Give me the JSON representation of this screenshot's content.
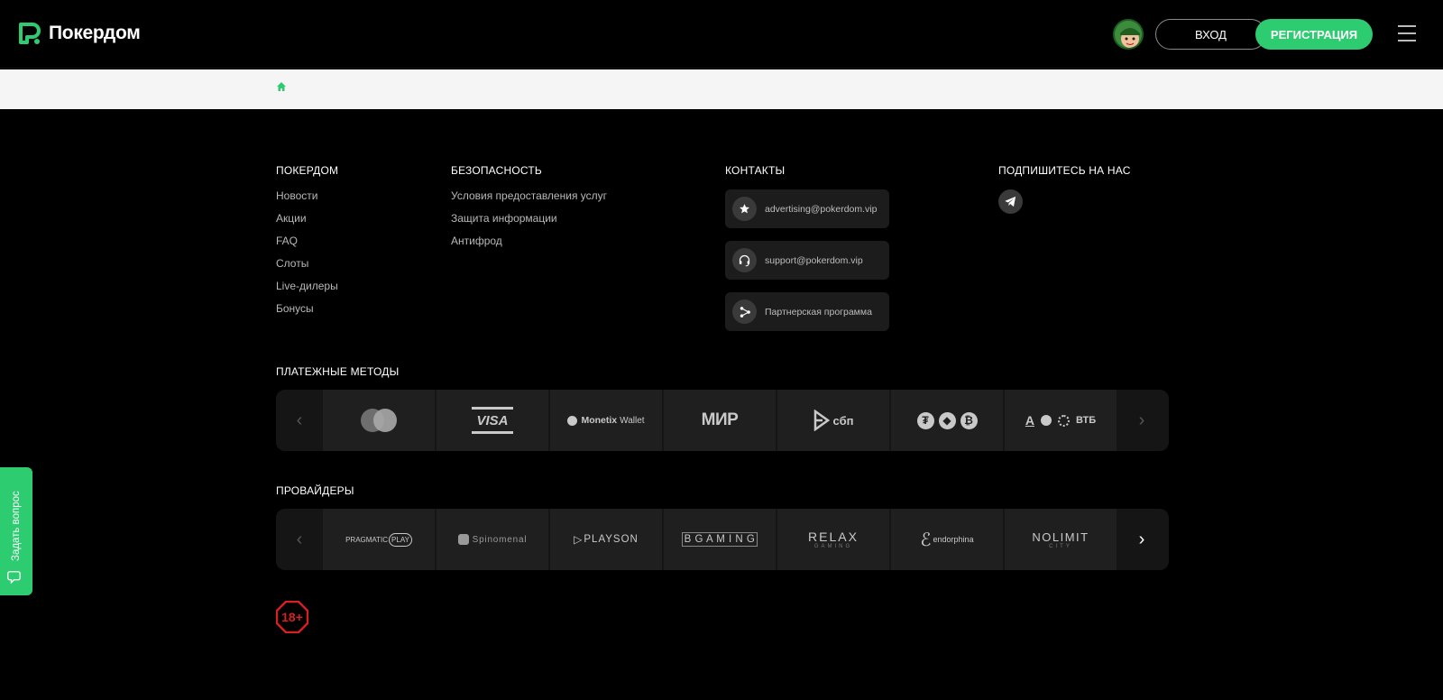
{
  "header": {
    "logo_text": "Покердом",
    "login_label": "ВХОД",
    "register_label": "РЕГИСТРАЦИЯ",
    "accent_color": "#2ecc71"
  },
  "footer": {
    "columns": [
      {
        "title": "ПОКЕРДОМ",
        "links": [
          "Новости",
          "Акции",
          "FAQ",
          "Слоты",
          "Live-дилеры",
          "Бонусы"
        ]
      },
      {
        "title": "БЕЗОПАСНОСТЬ",
        "links": [
          "Условия предоставления услуг",
          "Защита информации",
          "Антифрод"
        ]
      }
    ],
    "contacts": {
      "title": "КОНТАКТЫ",
      "items": [
        {
          "icon": "star-icon",
          "text": "advertising@pokerdom.vip"
        },
        {
          "icon": "headset-icon",
          "text": "support@pokerdom.vip"
        },
        {
          "icon": "share-icon",
          "text": "Партнерская программа"
        }
      ]
    },
    "social": {
      "title": "ПОДПИШИТЕСЬ НА НАС",
      "icon": "telegram-icon"
    }
  },
  "payments": {
    "title": "ПЛАТЕЖНЫЕ МЕТОДЫ",
    "items": [
      "Mastercard",
      "VISA",
      "Monetix Wallet",
      "МИР",
      "сбп",
      "Crypto",
      "Банки"
    ]
  },
  "providers": {
    "title": "ПРОВАЙДЕРЫ",
    "items": [
      "PRAGMATIC PLAY",
      "Spinomenal",
      "PLAYSON",
      "BGAMING",
      "RELAX GAMING",
      "endorphina",
      "NOLIMIT CITY"
    ]
  },
  "labels": {
    "visa": "VISA",
    "monetix": "Monetix",
    "wallet": "Wallet",
    "mir": "МИР",
    "sbp": "сбп",
    "vtb": "ВТБ",
    "pragmatic": "PRAGMATIC",
    "play": "PLAY",
    "spinomenal": "Spinomenal",
    "playson": "PLAYSON",
    "bgaming": "B G A M I N G",
    "relax": "RELAX",
    "relax_sub": "GAMING",
    "endorphina": "endorphina",
    "nolimit": "NOLIMIT",
    "nolimit_sub": "CITY",
    "age": "18+",
    "side_tab": "Задать вопрос"
  }
}
